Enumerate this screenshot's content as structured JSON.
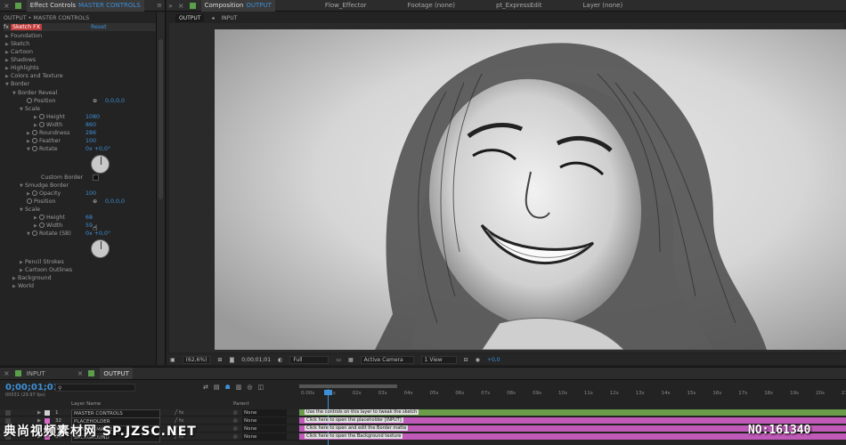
{
  "effect_controls": {
    "tab_label": "Effect Controls",
    "tab_layer": "MASTER CONTROLS",
    "breadcrumb": "OUTPUT • MASTER CONTROLS",
    "fx_name": "Sketch FX",
    "reset_label": "Reset",
    "rows": [
      {
        "label": "Foundation"
      },
      {
        "label": "Sketch"
      },
      {
        "label": "Cartoon"
      },
      {
        "label": "Shadows"
      },
      {
        "label": "Highlights"
      },
      {
        "label": "Colors and Texture"
      },
      {
        "label": "Border"
      },
      {
        "label": "Border Reveal"
      },
      {
        "label": "Position",
        "value": "0,0,0,0"
      },
      {
        "label": "Scale"
      },
      {
        "label": "Height",
        "value": "1080"
      },
      {
        "label": "Width",
        "value": "860"
      },
      {
        "label": "Roundness",
        "value": "286"
      },
      {
        "label": "Feather",
        "value": "100"
      },
      {
        "label": "Rotate",
        "value": "0x +0,0°"
      },
      {
        "label": "Custom Border"
      },
      {
        "label": "Smudge Border"
      },
      {
        "label": "Opacity",
        "value": "100"
      },
      {
        "label": "Position",
        "value": "0,0,0,0"
      },
      {
        "label": "Scale"
      },
      {
        "label": "Height",
        "value": "68"
      },
      {
        "label": "Width",
        "value": "59"
      },
      {
        "label": "Rotate (SB)",
        "value": "0x +0,0°"
      },
      {
        "label": "Pencil Strokes"
      },
      {
        "label": "Cartoon Outlines"
      },
      {
        "label": "Background"
      },
      {
        "label": "World"
      }
    ]
  },
  "composition": {
    "tab_label": "Composition",
    "tab_name": "OUTPUT",
    "other_tabs": [
      "Flow_Effector",
      "Footage (none)",
      "pt_ExpressEdit",
      "Layer (none)"
    ],
    "subtabs": [
      "OUTPUT",
      "INPUT"
    ],
    "viewer_bar": {
      "zoom": "(62,6%)",
      "timecode": "0;00;01;01",
      "resolution": "Full",
      "camera": "Active Camera",
      "views": "1 View",
      "exposure": "+0,0"
    }
  },
  "timeline": {
    "tabs": [
      "INPUT",
      "OUTPUT"
    ],
    "timecode": "0;00;01;01",
    "frame_info": "00031 (29.97 fps)",
    "search_placeholder": "",
    "col_layer_name": "Layer Name",
    "col_parent": "Parent",
    "ruler": [
      "0:00s",
      "01s",
      "02s",
      "03s",
      "04s",
      "05s",
      "06s",
      "07s",
      "08s",
      "09s",
      "10s",
      "11s",
      "12s",
      "13s",
      "14s",
      "15s",
      "16s",
      "17s",
      "18s",
      "19s",
      "20s",
      "21s"
    ],
    "layers": [
      {
        "num": "1",
        "name": "MASTER CONTROLS",
        "parent": "None",
        "bar_text": "Use the controls on this layer to tweak the sketch",
        "color": "#6a9c4a",
        "label": "#cfcfcf"
      },
      {
        "num": "32",
        "name": "PLACEHOLDER",
        "parent": "None",
        "bar_text": "Click here to open the placeholder [INPUT]",
        "color": "#c05ab8",
        "label": "#d868c8"
      },
      {
        "num": "33",
        "name": "BORDER MATTE",
        "parent": "None",
        "bar_text": "Click here to open and edit the Border matte",
        "color": "#c05ab8",
        "label": "#d868c8"
      },
      {
        "num": "34",
        "name": "BACKGROUND",
        "parent": "None",
        "bar_text": "Click here to open the Background texture",
        "color": "#c05ab8",
        "label": "#d868c8"
      }
    ]
  },
  "watermark": {
    "left": "典尚视频素材网 SP.JZSC.NET",
    "right": "NO:161340"
  }
}
